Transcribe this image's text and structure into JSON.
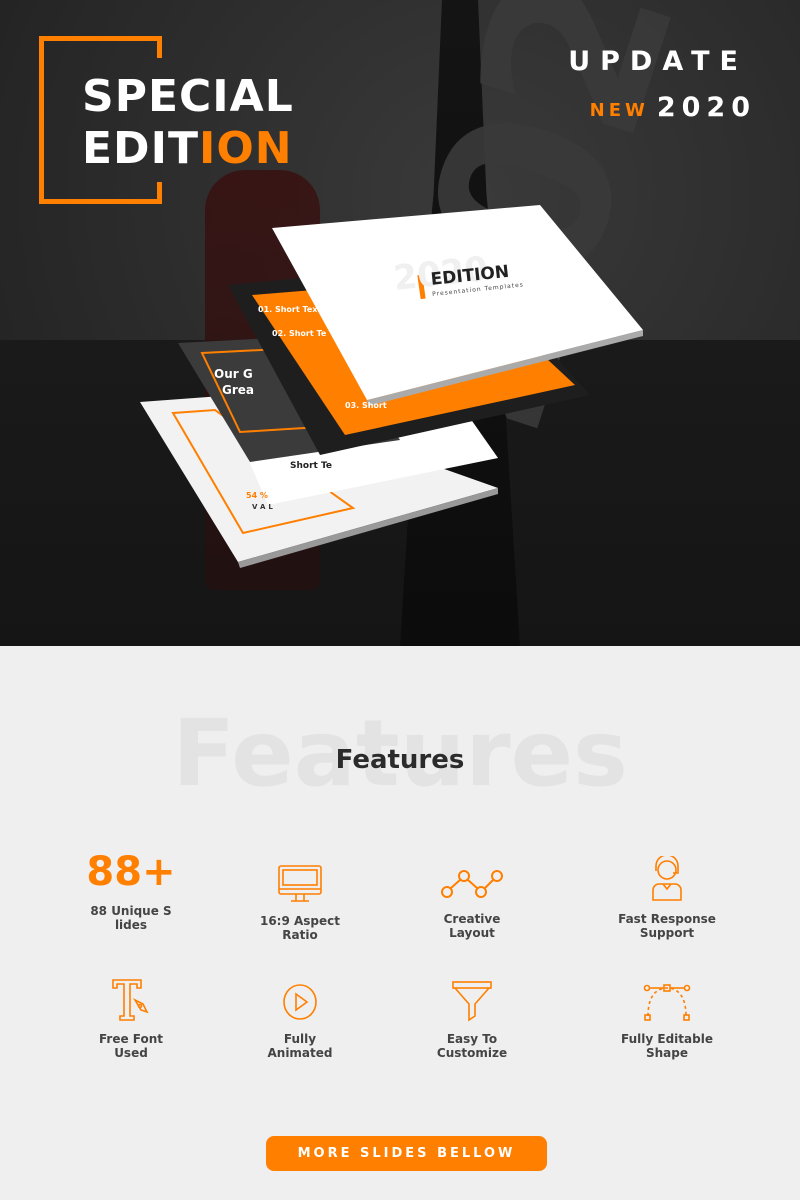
{
  "hero": {
    "title_line1": "SPECIAL",
    "title_line2_white": "EDIT",
    "title_line2_orange": "ION",
    "update": "UPDATE",
    "new": "NEW",
    "year": "2020",
    "watermark": "2020",
    "slides": {
      "main_title": "EDITION",
      "main_subtitle": "Presentation Templates",
      "main_watermark": "2020",
      "orange_items": [
        "01. Short Text",
        "02. Short Te",
        "03. Short"
      ],
      "dark_title_1": "Our G",
      "dark_title_2": "Grea",
      "short_text": "Short Te",
      "percent": "54 %",
      "val": "VAL"
    }
  },
  "colors": {
    "accent": "#ff7f00",
    "hero_bg": "#262626",
    "page_bg": "#efefef"
  },
  "features": {
    "watermark": "Features",
    "title": "Features",
    "items": [
      {
        "icon": "88-plus",
        "big": "88+",
        "label1": "88 Unique S",
        "label2": "lides"
      },
      {
        "icon": "monitor-icon",
        "label1": "16:9 Aspect",
        "label2": "Ratio"
      },
      {
        "icon": "line-chart-icon",
        "label1": "Creative",
        "label2": "Layout"
      },
      {
        "icon": "support-agent-icon",
        "label1": "Fast Response",
        "label2": "Support"
      },
      {
        "icon": "font-pen-icon",
        "label1": "Free Font",
        "label2": "Used"
      },
      {
        "icon": "play-icon",
        "label1": "Fully",
        "label2": "Animated"
      },
      {
        "icon": "funnel-icon",
        "label1": "Easy To",
        "label2": "Customize"
      },
      {
        "icon": "bezier-icon",
        "label1": "Fully Editable",
        "label2": "Shape"
      }
    ]
  },
  "cta": {
    "label": "MORE SLIDES BELLOW"
  }
}
